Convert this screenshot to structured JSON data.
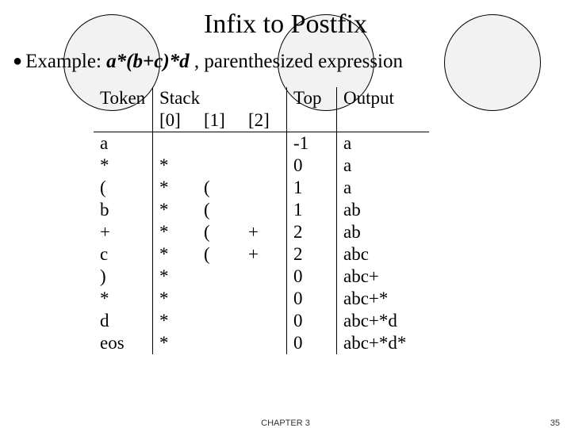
{
  "title": "Infix to Postfix",
  "subhead": {
    "lead": "Example: ",
    "expr": "a*(b+c)*d",
    "rest": " , parenthesized expression"
  },
  "cols": {
    "token": "Token",
    "stack": "Stack",
    "s0": "[0]",
    "s1": "[1]",
    "s2": "[2]",
    "top": "Top",
    "output": "Output"
  },
  "rows": [
    {
      "token": "a",
      "s0": "",
      "s1": "",
      "s2": "",
      "top": "-1",
      "output": "a"
    },
    {
      "token": "*",
      "s0": "*",
      "s1": "",
      "s2": "",
      "top": "0",
      "output": "a"
    },
    {
      "token": "(",
      "s0": "*",
      "s1": "(",
      "s2": "",
      "top": "1",
      "output": "a"
    },
    {
      "token": "b",
      "s0": "*",
      "s1": "(",
      "s2": "",
      "top": "1",
      "output": "ab"
    },
    {
      "token": "+",
      "s0": "*",
      "s1": "(",
      "s2": "+",
      "top": "2",
      "output": "ab"
    },
    {
      "token": "c",
      "s0": "*",
      "s1": "(",
      "s2": "+",
      "top": "2",
      "output": "abc"
    },
    {
      "token": ")",
      "s0": "*",
      "s1": "",
      "s2": "",
      "top": "0",
      "output": "abc+"
    },
    {
      "token": "*",
      "s0": "*",
      "s1": "",
      "s2": "",
      "top": "0",
      "output": "abc+*"
    },
    {
      "token": "d",
      "s0": "*",
      "s1": "",
      "s2": "",
      "top": "0",
      "output": "abc+*d"
    },
    {
      "token": "eos",
      "s0": "*",
      "s1": "",
      "s2": "",
      "top": "0",
      "output": "abc+*d*"
    }
  ],
  "footer": {
    "chapter": "CHAPTER 3",
    "page": "35"
  },
  "chart_data": {
    "type": "table",
    "title": "Infix to Postfix trace for a*(b+c)*d",
    "columns": [
      "Token",
      "Stack[0]",
      "Stack[1]",
      "Stack[2]",
      "Top",
      "Output"
    ],
    "rows": [
      [
        "a",
        "",
        "",
        "",
        -1,
        "a"
      ],
      [
        "*",
        "*",
        "",
        "",
        0,
        "a"
      ],
      [
        "(",
        "*",
        "(",
        "",
        1,
        "a"
      ],
      [
        "b",
        "*",
        "(",
        "",
        1,
        "ab"
      ],
      [
        "+",
        "*",
        "(",
        "+",
        2,
        "ab"
      ],
      [
        "c",
        "*",
        "(",
        "+",
        2,
        "abc"
      ],
      [
        ")",
        "*",
        "",
        "",
        0,
        "abc+"
      ],
      [
        "*",
        "*",
        "",
        "",
        0,
        "abc+*"
      ],
      [
        "d",
        "*",
        "",
        "",
        0,
        "abc+*d"
      ],
      [
        "eos",
        "*",
        "",
        "",
        0,
        "abc+*d*"
      ]
    ]
  }
}
